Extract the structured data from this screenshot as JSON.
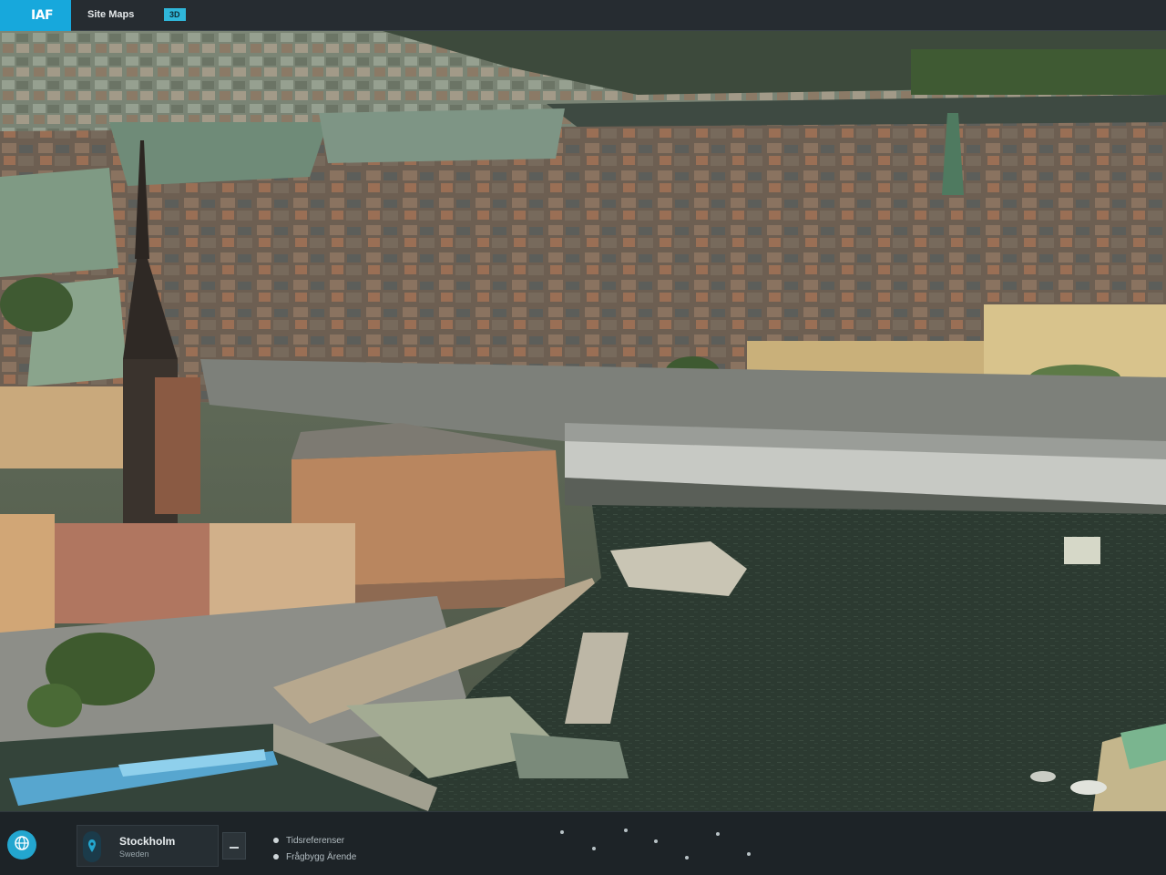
{
  "header": {
    "brand": "IAF",
    "app_title": "Site Maps",
    "version_badge": "3D"
  },
  "map": {
    "kind": "3d-aerial-city-view",
    "water_color": "#2e3a30",
    "rooftop_color": "#8a6a52",
    "spire_color": "#3a332d"
  },
  "footer": {
    "home_icon": "globe-icon",
    "location": {
      "name": "Stockholm",
      "country": "Sweden"
    },
    "layers": [
      {
        "label": "Tidsreferenser"
      },
      {
        "label": "Frågbygg Ärende"
      }
    ],
    "accent_color": "#23a6cf"
  }
}
